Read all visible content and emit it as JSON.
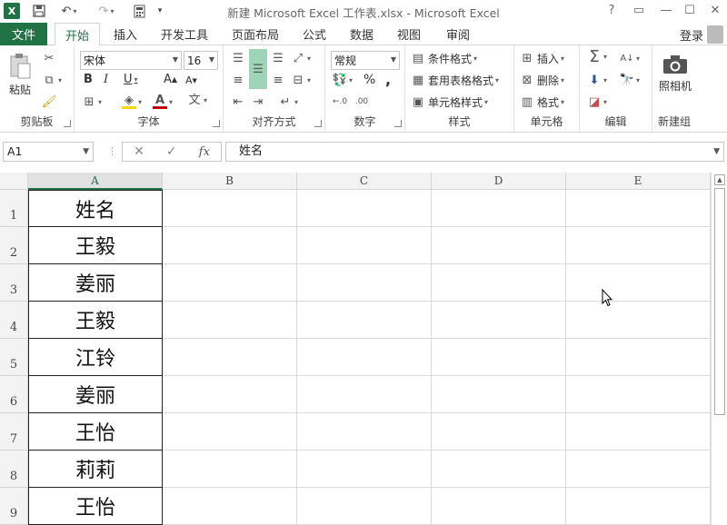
{
  "window": {
    "title": "新建 Microsoft Excel 工作表.xlsx - Microsoft Excel",
    "controls": [
      "?",
      "▭",
      "—",
      "☐",
      "✕"
    ]
  },
  "tabs": {
    "file": "文件",
    "items": [
      "开始",
      "插入",
      "开发工具",
      "页面布局",
      "公式",
      "数据",
      "视图",
      "审阅"
    ],
    "login": "登录"
  },
  "ribbon": {
    "clipboard": {
      "paste": "粘贴",
      "label": "剪贴板"
    },
    "font": {
      "name": "宋体",
      "size": "16",
      "label": "字体",
      "bold": "B",
      "italic": "I",
      "underline": "U",
      "grow": "A",
      "shrink": "A"
    },
    "alignment": {
      "label": "对齐方式"
    },
    "number": {
      "format": "常规",
      "label": "数字",
      "percent": "%",
      "comma": ","
    },
    "styles": {
      "conditional": "条件格式",
      "table": "套用表格格式",
      "cell": "单元格样式",
      "label": "样式"
    },
    "cells": {
      "insert": "插入",
      "delete": "删除",
      "format": "格式",
      "label": "单元格"
    },
    "editing": {
      "label": "编辑"
    },
    "camera": {
      "button": "照相机",
      "label": "新建组"
    }
  },
  "formula_bar": {
    "name_box": "A1",
    "fx": "fx",
    "value": "姓名"
  },
  "grid": {
    "columns": [
      "A",
      "B",
      "C",
      "D",
      "E"
    ],
    "rows": [
      "1",
      "2",
      "3",
      "4",
      "5",
      "6",
      "7",
      "8",
      "9"
    ],
    "column_a_values": [
      "姓名",
      "王毅",
      "姜丽",
      "王毅",
      "江铃",
      "姜丽",
      "王怡",
      "莉莉",
      "王怡"
    ]
  }
}
